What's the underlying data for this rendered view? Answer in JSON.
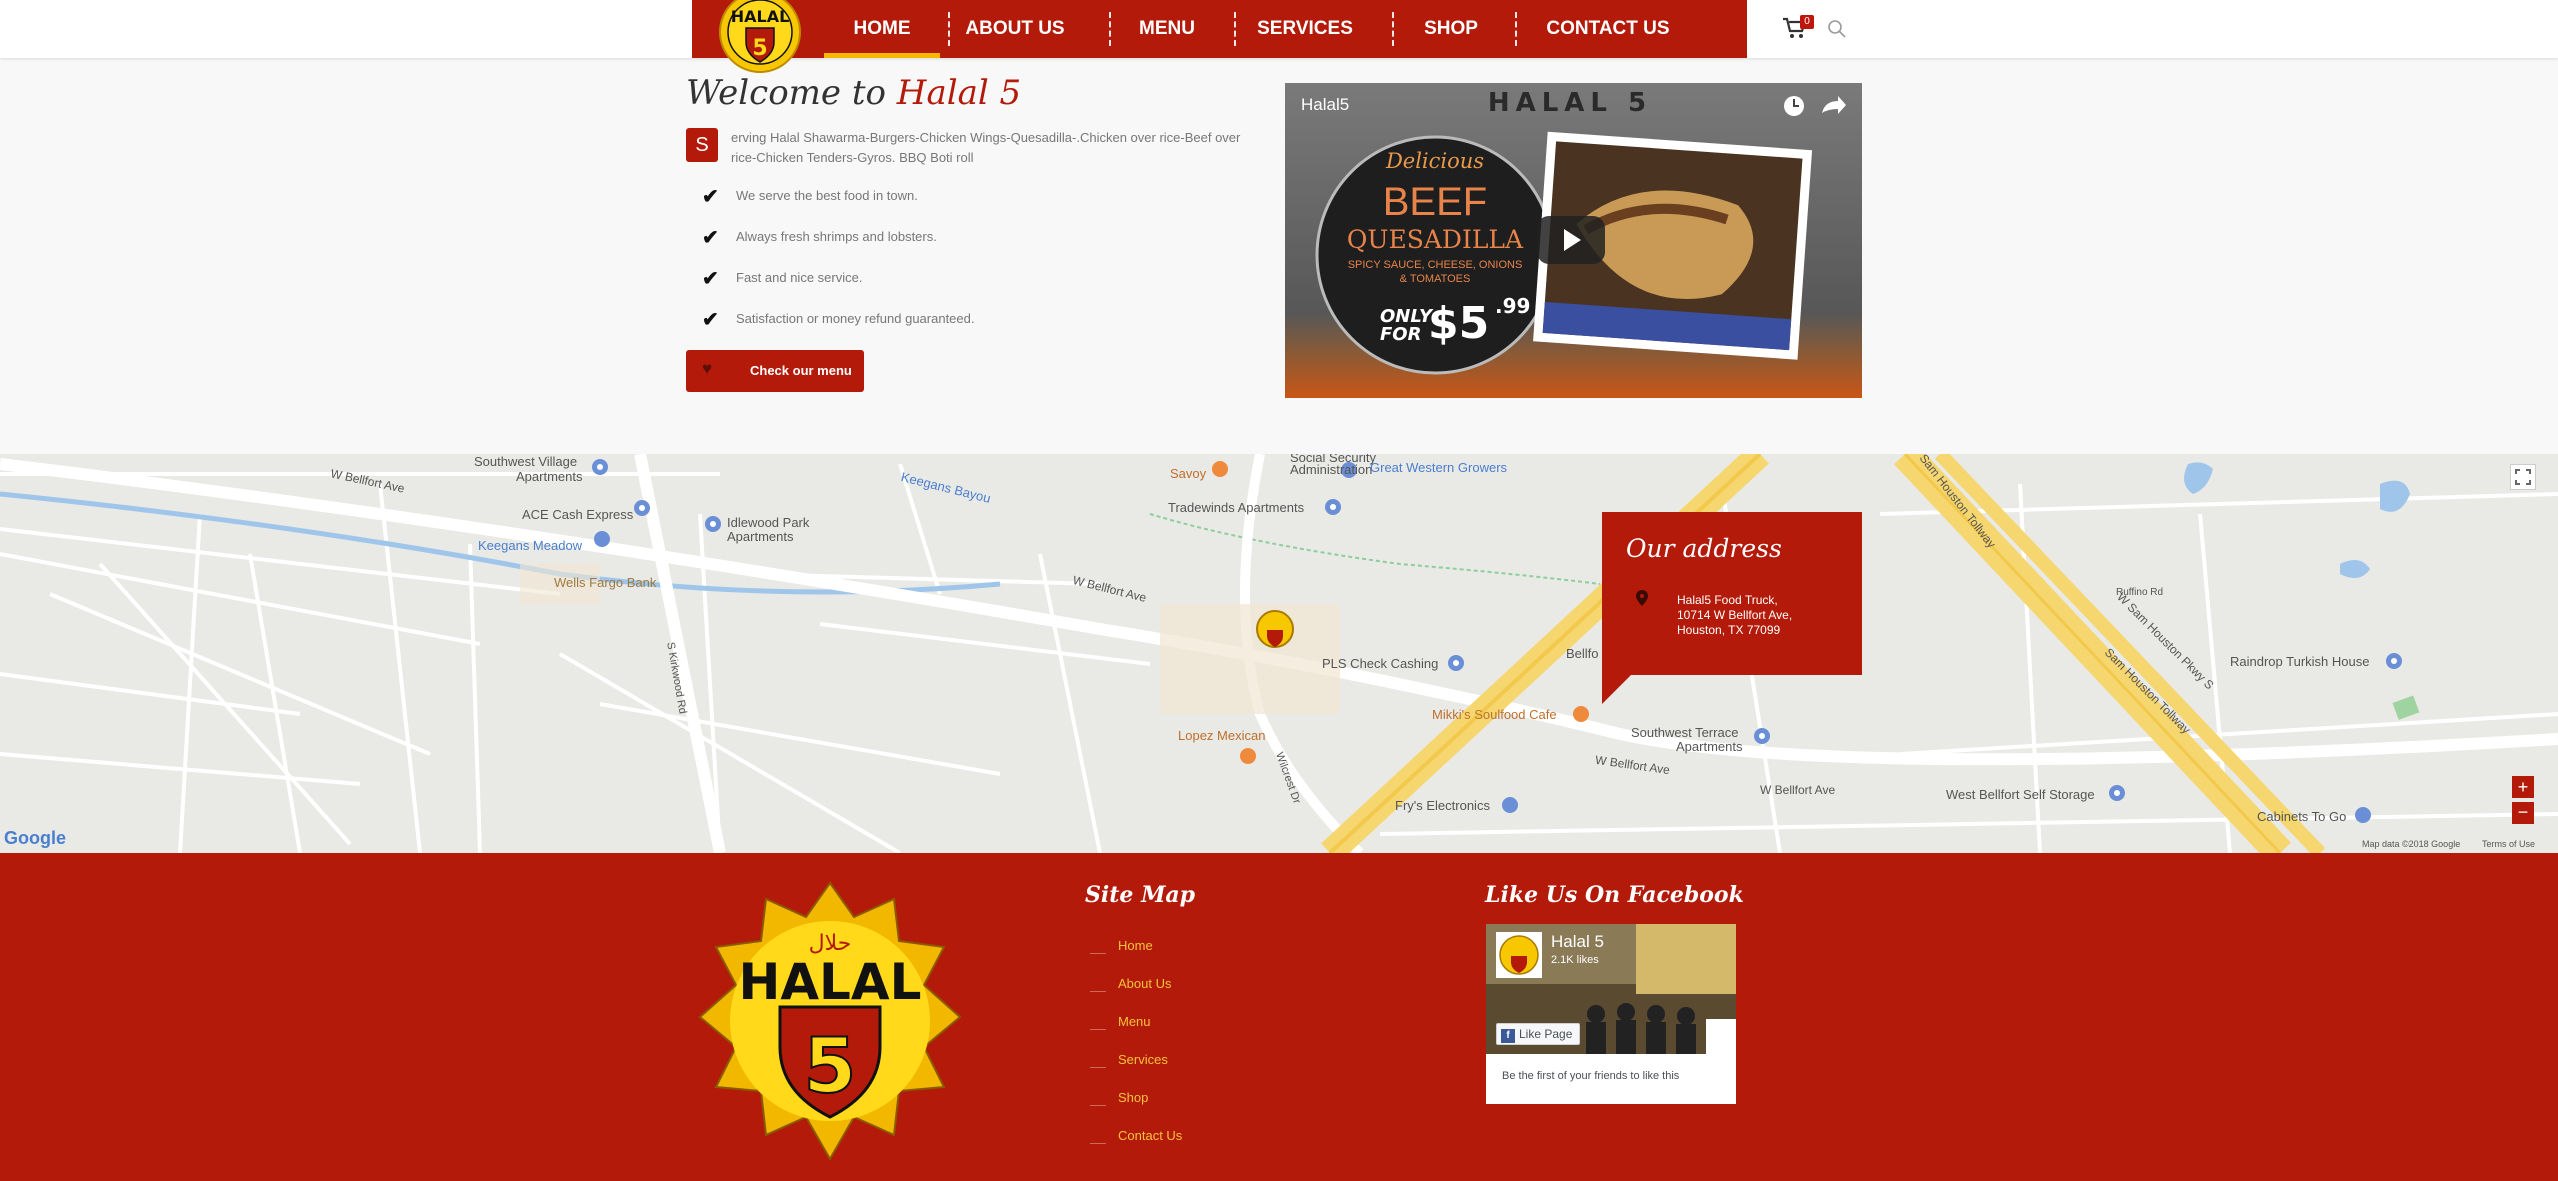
{
  "nav": {
    "items": [
      {
        "label": "HOME",
        "active": true
      },
      {
        "label": "ABOUT US",
        "active": false
      },
      {
        "label": "MENU",
        "active": false
      },
      {
        "label": "SERVICES",
        "active": false
      },
      {
        "label": "SHOP",
        "active": false
      },
      {
        "label": "CONTACT US",
        "active": false
      }
    ],
    "cart_count": "0",
    "logo_text": "HALAL",
    "logo_number": "5",
    "logo_arabic": "حلال"
  },
  "welcome": {
    "title_prefix": "Welcome to ",
    "title_brand": "Halal 5",
    "dropcap": "S",
    "intro": "erving Halal Shawarma-Burgers-Chicken Wings-Quesadilla-.Chicken over rice-Beef over rice-Chicken Tenders-Gyros. BBQ Boti roll",
    "checklist": [
      "We serve the best food in town.",
      "Always fresh shrimps and lobsters.",
      "Fast and nice service.",
      "Satisfaction or money refund guaranteed."
    ],
    "menu_button": "Check our menu"
  },
  "video": {
    "channel": "Halal5",
    "banner": "HALAL 5",
    "promo_line1": "Delicious",
    "promo_line2": "BEEF",
    "promo_line3": "QUESADILLA",
    "promo_line4": "SPICY SAUCE, CHEESE, ONIONS",
    "promo_line5": "& TOMATOES",
    "promo_only": "ONLY",
    "promo_for": "FOR",
    "promo_price": "$5",
    "promo_cents": ".99"
  },
  "map": {
    "labels": {
      "southwest_village": "Southwest Village",
      "southwest_village2": "Apartments",
      "ace": "ACE Cash Express",
      "keegans_meadow": "Keegans Meadow",
      "wells_fargo": "Wells Fargo Bank",
      "idlewood": "Idlewood Park",
      "idlewood2": "Apartments",
      "keegans_bayou": "Keegans Bayou",
      "savoy": "Savoy",
      "social_security": "Social Security",
      "administration": "Administration",
      "great_western": "Great Western Growers",
      "tradewinds": "Tradewinds Apartments",
      "pls": "PLS Check Cashing",
      "lopez": "Lopez Mexican",
      "mikkis": "Mikki's Soulfood Cafe",
      "southwest_terrace": "Southwest Terrace",
      "southwest_terrace2": "Apartments",
      "frys": "Fry's Electronics",
      "raindrop": "Raindrop Turkish House",
      "west_bellfort_storage": "West Bellfort Self Storage",
      "cabinets": "Cabinets To Go",
      "ruffino": "Ruffino Rd",
      "sam_houston_tollway": "Sam Houston Tollway",
      "w_sam_houston": "W Sam Houston Pkwy S",
      "sam_houston_tollway2": "Sam Houston Tollway",
      "w_bellfort": "W Bellfort Ave",
      "kirkwood": "S Kirkwood Rd",
      "wilcrest": "Wilcrest Dr",
      "bellfort_partial": "Bellfo",
      "footer_data": "Map data ©2018 Google",
      "terms": "Terms of Use",
      "google": "Google"
    }
  },
  "address": {
    "title": "Our address",
    "line1": "Halal5 Food Truck,",
    "line2": "10714 W Bellfort Ave,",
    "line3": "Houston, TX 77099"
  },
  "footer": {
    "sitemap_title": "Site Map",
    "links": [
      "Home",
      "About Us",
      "Menu",
      "Services",
      "Shop",
      "Contact Us"
    ],
    "facebook_title": "Like Us On Facebook",
    "fb_page_name": "Halal 5",
    "fb_likes": "2.1K likes",
    "fb_like_button": "Like Page",
    "fb_friends": "Be the first of your friends to like this"
  },
  "colors": {
    "brand_red": "#b31a0a",
    "brand_yellow": "#f7b800",
    "link_yellow": "#f6c33b"
  }
}
